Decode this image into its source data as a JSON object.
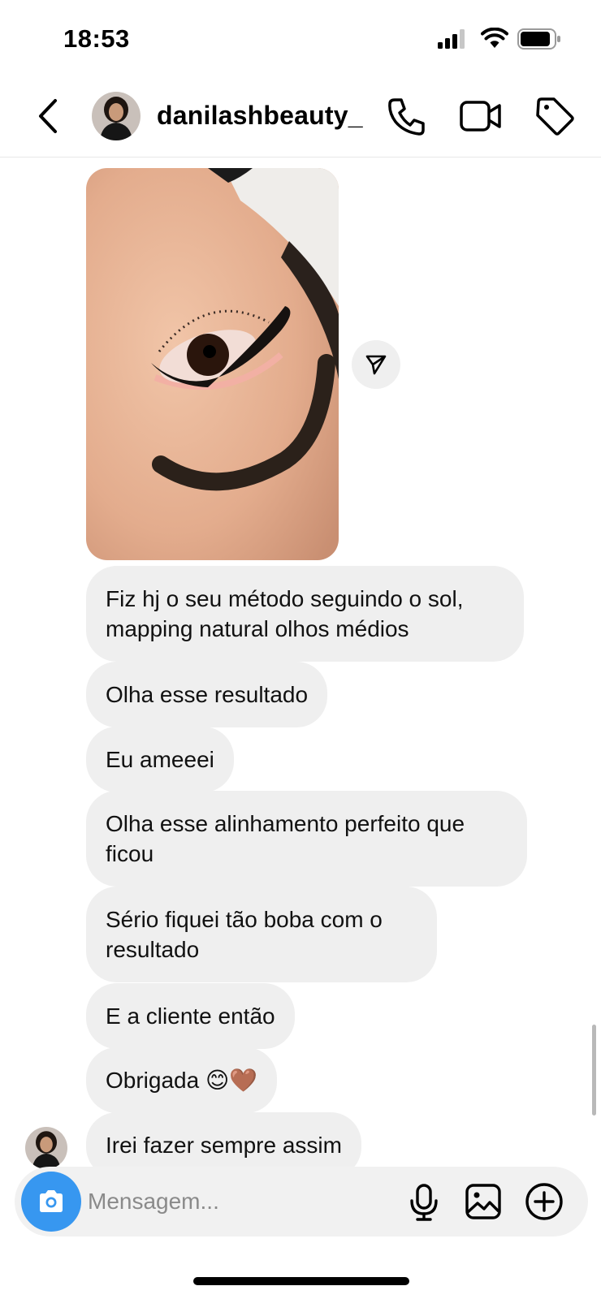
{
  "status_bar": {
    "time": "18:53",
    "icons": [
      "cellular-signal-icon",
      "wifi-icon",
      "battery-icon"
    ]
  },
  "header": {
    "username": "danilashbeauty_",
    "icons": [
      "back-chevron-icon",
      "phone-icon",
      "video-camera-icon",
      "tag-icon"
    ]
  },
  "messages": [
    {
      "type": "image",
      "description_icon": "photo",
      "share_icon": "paper-plane-icon"
    },
    {
      "type": "text",
      "text": "Fiz hj o seu método seguindo o sol, mapping natural olhos médios"
    },
    {
      "type": "text",
      "text": "Olha esse resultado"
    },
    {
      "type": "text",
      "text": "Eu ameeei"
    },
    {
      "type": "text",
      "text": "Olha esse alinhamento perfeito que ficou"
    },
    {
      "type": "text",
      "text": "Sério fiquei tão boba com o resultado"
    },
    {
      "type": "text",
      "text": "E a cliente então"
    },
    {
      "type": "text",
      "text": "Obrigada 😊🤎"
    },
    {
      "type": "text",
      "text": "Irei fazer sempre assim"
    }
  ],
  "composer": {
    "placeholder": "Mensagem...",
    "icons": [
      "camera-icon",
      "microphone-icon",
      "gallery-icon",
      "plus-circle-icon"
    ]
  },
  "colors": {
    "accent": "#3797f0",
    "bubble": "#efefef",
    "background": "#ffffff",
    "text": "#000000"
  }
}
